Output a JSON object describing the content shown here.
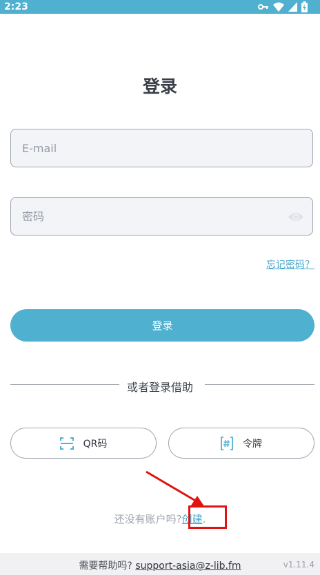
{
  "status_bar": {
    "time": "2:23"
  },
  "login": {
    "title": "登录",
    "email_placeholder": "E-mail",
    "password_placeholder": "密码",
    "forgot_password": "忘记密码？",
    "login_button": "登录"
  },
  "alternative": {
    "divider_text": "或者登录借助",
    "qr_label": "QR码",
    "token_label": "令牌"
  },
  "signup": {
    "prompt": "还没有账户吗?",
    "create_link": "创建",
    "period": "."
  },
  "footer": {
    "help_text": "需要帮助吗?",
    "support_email": "support-asia@z-lib.fm",
    "version": "v1.11.4"
  },
  "icons": {
    "status": [
      "key-icon",
      "wifi-icon",
      "signal-icon",
      "battery-icon"
    ],
    "password_toggle": "eye-icon",
    "qr": "qr-scan-icon",
    "token": "hash-token-icon"
  },
  "colors": {
    "accent": "#4fb0d0",
    "link": "#46a9cc",
    "annotation": "#e11212"
  }
}
